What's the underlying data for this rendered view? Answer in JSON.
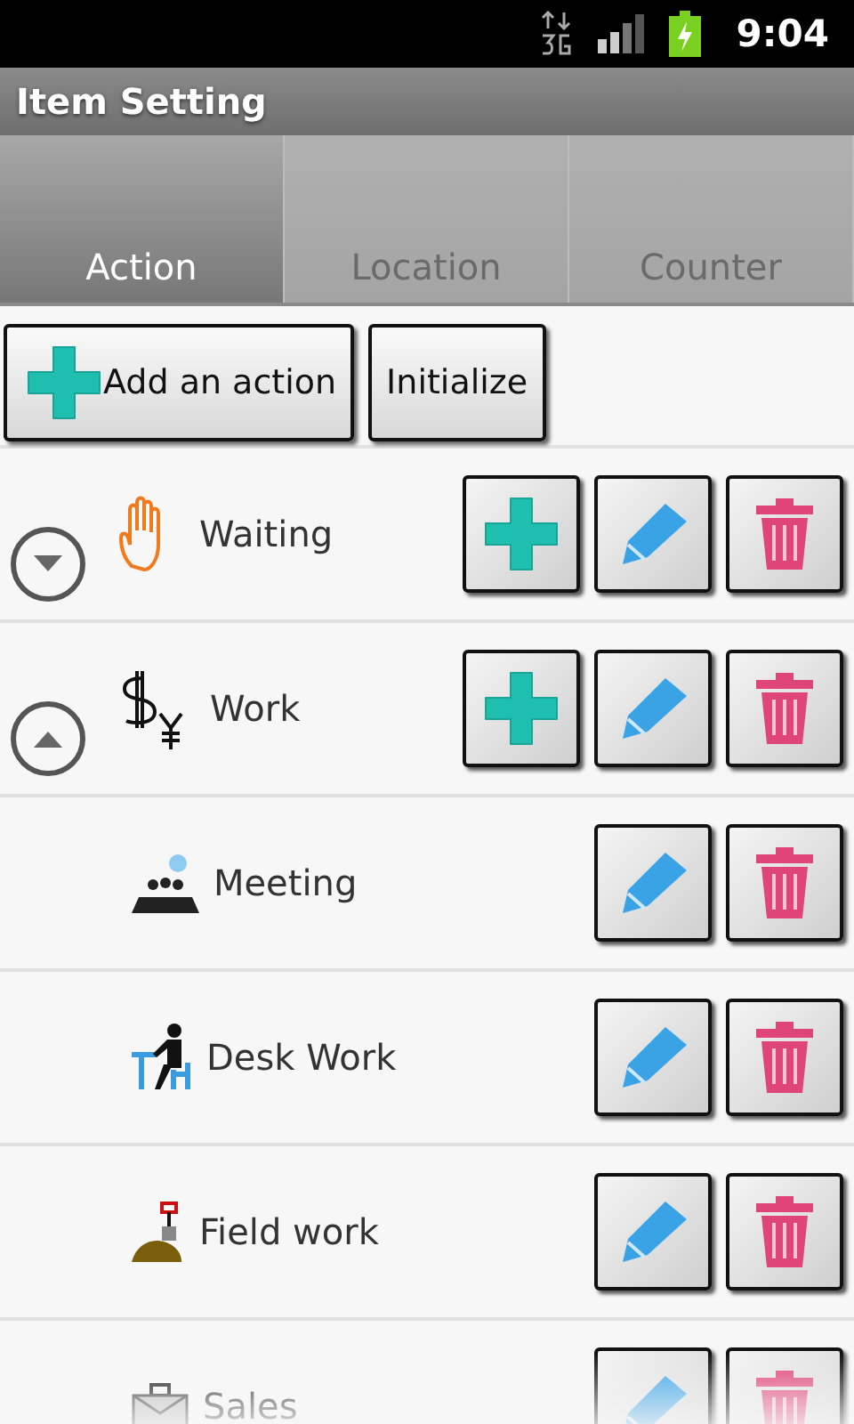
{
  "status_bar": {
    "time": "9:04"
  },
  "window": {
    "title": "Item Setting"
  },
  "tabs": [
    {
      "label": "Action",
      "selected": true
    },
    {
      "label": "Location",
      "selected": false
    },
    {
      "label": "Counter",
      "selected": false
    }
  ],
  "toolbar": {
    "add_label": "Add an action",
    "initialize_label": "Initialize"
  },
  "actions": [
    {
      "label": "Waiting",
      "kind": "hand",
      "expanded": false
    },
    {
      "label": "Work",
      "kind": "money",
      "expanded": true,
      "children": [
        {
          "label": "Meeting",
          "kind": "meeting"
        },
        {
          "label": "Desk Work",
          "kind": "desk"
        },
        {
          "label": "Field work",
          "kind": "field"
        },
        {
          "label": "Sales",
          "kind": "sales"
        }
      ]
    }
  ]
}
